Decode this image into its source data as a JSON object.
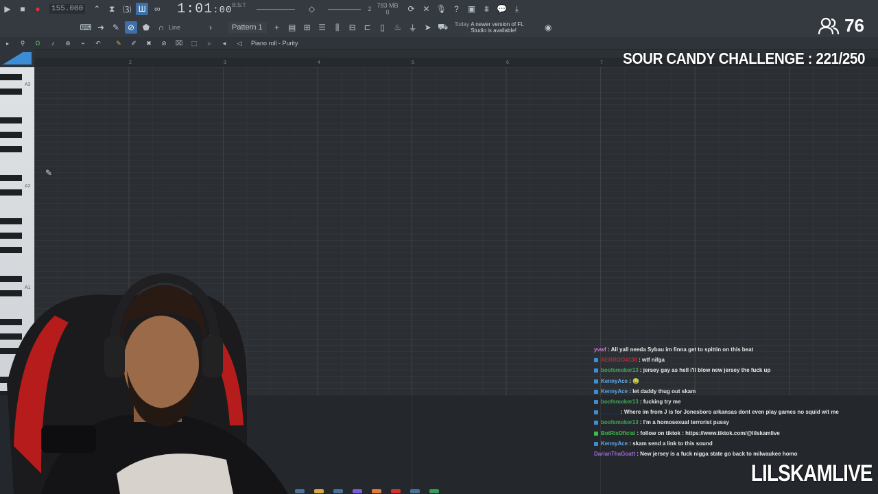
{
  "toolbar": {
    "tempo": "155.000",
    "time": "1:01",
    "time_frac": ":00",
    "time_suffix": "B:S:T",
    "cpu_num": "2",
    "mem": "783 MB",
    "mem_num": "0",
    "mode_label": "Line",
    "pattern_label": "Pattern 1",
    "news_day": "Today",
    "news_text": "A newer version of FL Studio is available!"
  },
  "piano_roll": {
    "title": "Piano roll - Purity",
    "bar_numbers": [
      "2",
      "3",
      "4",
      "5",
      "6",
      "7"
    ],
    "octave_labels": [
      "A3",
      "A2",
      "A1"
    ]
  },
  "overlay": {
    "viewer_count": "76",
    "challenge_text": "SOUR CANDY CHALLENGE : 221/250",
    "channel_name": "LILSKAMLIVE"
  },
  "chat": [
    {
      "user": "yvwf",
      "color": "#d07ad6",
      "badge": "",
      "text": " : All yall needa Sybau im finna get to spittin on this beat"
    },
    {
      "user": "AERROO4138",
      "color": "#c0283a",
      "badge": "blue",
      "text": " : wtf nifga"
    },
    {
      "user": "boofsmoker13",
      "color": "#3fa85a",
      "badge": "blue",
      "text": " : jersey gay as hell i'll blow new jersey the fuck up"
    },
    {
      "user": "KennyAce",
      "color": "#5fa8e6",
      "badge": "blue",
      "text": " : 🤢"
    },
    {
      "user": "KennyAce",
      "color": "#5fa8e6",
      "badge": "blue",
      "text": " : let daddy thug out skam"
    },
    {
      "user": "boofsmoker13",
      "color": "#3fa85a",
      "badge": "blue",
      "text": " : fucking try me"
    },
    {
      "user": "______",
      "color": "#2b3dbf",
      "badge": "blue",
      "text": " : Where im from J is for Jonesboro arkansas dont even play games no squid wit me"
    },
    {
      "user": "boofsmoker13",
      "color": "#3fa85a",
      "badge": "blue",
      "text": " : I'm a homosexual terrorist pussy"
    },
    {
      "user": "BotRixOficial",
      "color": "#3ac048",
      "badge": "green",
      "text": " : follow on tiktok : https://www.tiktok.com/@lilskamlive"
    },
    {
      "user": "KennyAce",
      "color": "#5fa8e6",
      "badge": "blue",
      "text": " : skam send a link to this sound"
    },
    {
      "user": "DarianThaGoatt",
      "color": "#a36bd9",
      "badge": "",
      "text": " : New jersey is a fuck nigga state go back to milwaukee homo"
    }
  ]
}
